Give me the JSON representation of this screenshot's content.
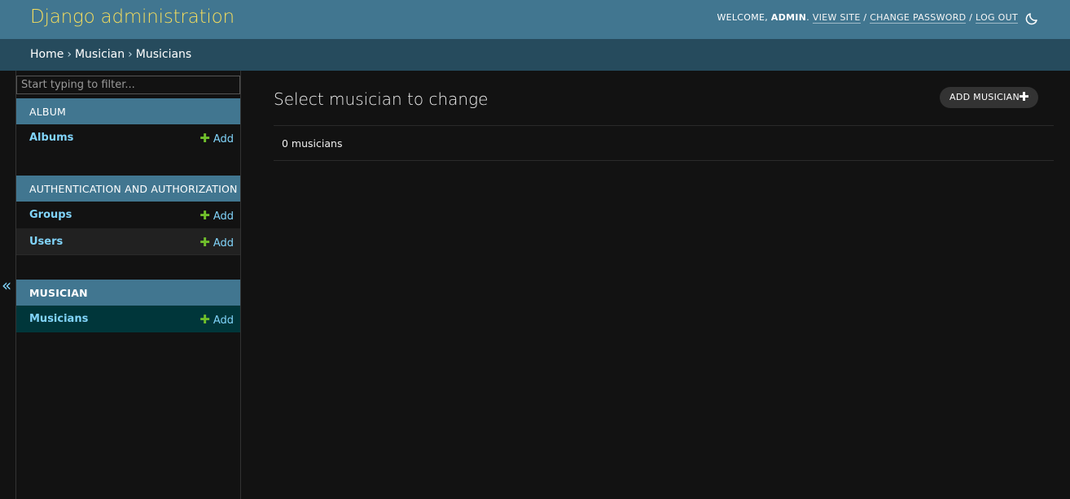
{
  "header": {
    "site_name": "Django administration",
    "welcome_prefix": "WELCOME,",
    "username": "ADMIN",
    "view_site": "VIEW SITE",
    "change_password": "CHANGE PASSWORD",
    "log_out": "LOG OUT",
    "separator": "/",
    "theme_icon": "moon-icon"
  },
  "breadcrumbs": {
    "items": [
      "Home",
      "Musician",
      "Musicians"
    ],
    "separator": "›"
  },
  "sidebar": {
    "collapse_glyph": "«",
    "filter_placeholder": "Start typing to filter...",
    "add_label": "Add",
    "add_glyph": "✚",
    "modules": [
      {
        "caption": "ALBUM",
        "models": [
          "Albums"
        ]
      },
      {
        "caption": "AUTHENTICATION AND AUTHORIZATION",
        "models": [
          "Groups",
          "Users"
        ]
      },
      {
        "caption": "MUSICIAN",
        "models": [
          "Musicians"
        ],
        "current": true
      }
    ]
  },
  "content": {
    "title": "Select musician to change",
    "add_button": "ADD MUSICIAN",
    "add_button_glyph": "✚",
    "result_count": "0 musicians"
  },
  "colors": {
    "header_bg": "#417690",
    "breadcrumb_bg": "#264b5d",
    "site_name": "#f5dd5d",
    "link": "#81d4fa",
    "add_plus": "#70bf2b",
    "current_row": "#00363a",
    "body_bg": "#121212"
  }
}
